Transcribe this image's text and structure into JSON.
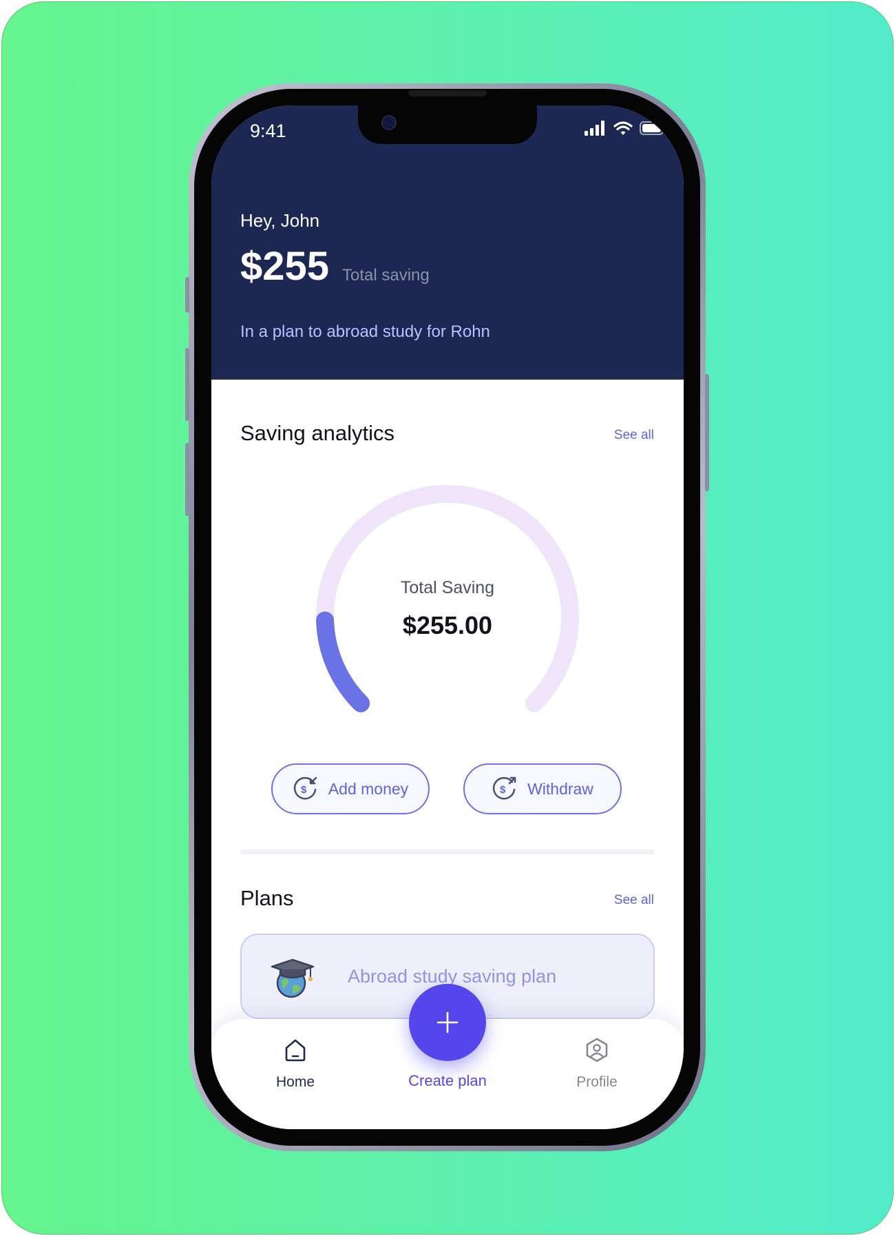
{
  "status_bar": {
    "time": "9:41"
  },
  "header": {
    "greeting": "Hey, John",
    "balance": "$255",
    "balance_label": "Total saving",
    "plan_subtitle": "In a plan to abroad study for Rohn"
  },
  "analytics": {
    "title": "Saving analytics",
    "see_all": "See all",
    "gauge_label": "Total Saving",
    "gauge_value": "$255.00",
    "progress_fraction": 0.16,
    "track_color": "#efe4fa",
    "progress_color": "#6a73e6"
  },
  "actions": {
    "add_money": "Add money",
    "withdraw": "Withdraw"
  },
  "plans": {
    "title": "Plans",
    "see_all": "See all",
    "items": [
      {
        "label": "Abroad study saving plan",
        "icon": "graduation-globe-icon"
      }
    ]
  },
  "tabbar": {
    "home": "Home",
    "create_plan": "Create plan",
    "profile": "Profile"
  },
  "colors": {
    "header_bg": "#1c2852",
    "accent": "#5546ec",
    "link": "#5b65d8"
  }
}
